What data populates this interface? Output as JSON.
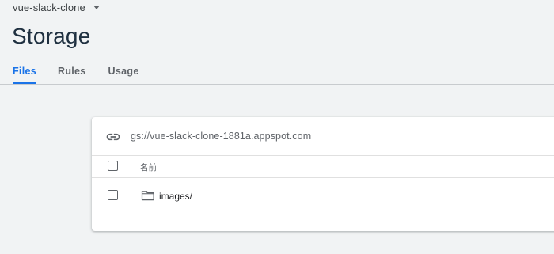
{
  "header": {
    "project_name": "vue-slack-clone",
    "dropdown_icon": "caret-down-icon"
  },
  "page": {
    "title": "Storage"
  },
  "tabs": [
    {
      "label": "Files",
      "active": true
    },
    {
      "label": "Rules",
      "active": false
    },
    {
      "label": "Usage",
      "active": false
    }
  ],
  "storage_browser": {
    "bucket_path": "gs://vue-slack-clone-1881a.appspot.com",
    "path_icon": "link-icon",
    "columns": [
      {
        "label": "名前"
      }
    ],
    "rows": [
      {
        "name": "images/",
        "type": "folder",
        "icon": "folder-icon",
        "selected": false
      }
    ]
  },
  "colors": {
    "accent": "#1a73e8",
    "background": "#f1f3f4",
    "title": "#1f3040",
    "muted_text": "#5f6368"
  }
}
